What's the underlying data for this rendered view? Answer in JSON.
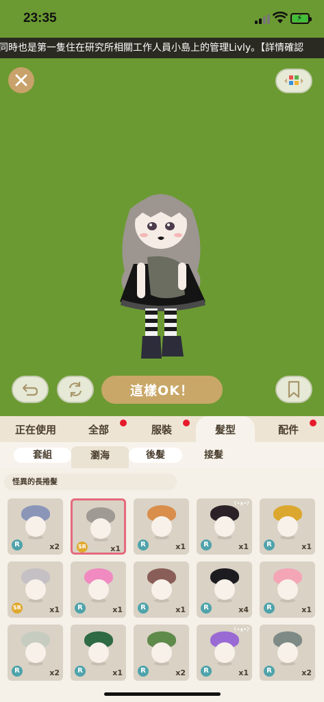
{
  "status_bar": {
    "time": "23:35"
  },
  "ticker": {
    "text": "同時也是第一隻住在研究所相關工作人員小島上的管理Livly。【詳情確認"
  },
  "stage": {
    "ok_label": "這樣OK！",
    "background_color": "#6b9a32"
  },
  "tabs": [
    {
      "label": "正在使用",
      "dot": false
    },
    {
      "label": "全部",
      "dot": true
    },
    {
      "label": "服裝",
      "dot": true
    },
    {
      "label": "髮型",
      "dot": false,
      "active": true
    },
    {
      "label": "配件",
      "dot": true
    }
  ],
  "subtabs": [
    {
      "label": "套組"
    },
    {
      "label": "瀏海",
      "active": true
    },
    {
      "label": "後髮"
    },
    {
      "label": "接髮"
    }
  ],
  "item_name": "怪異的長捲髮",
  "items": [
    {
      "rarity": "R",
      "count": "x2",
      "hair": "#8a95b8",
      "bear": false
    },
    {
      "rarity": "SR",
      "count": "x1",
      "hair": "#a09a94",
      "bear": false,
      "selected": true
    },
    {
      "rarity": "R",
      "count": "x1",
      "hair": "#d98e4c",
      "bear": false
    },
    {
      "rarity": "R",
      "count": "x1",
      "hair": "#2a2226",
      "bear": true
    },
    {
      "rarity": "R",
      "count": "x1",
      "hair": "#dca72e",
      "bear": false
    },
    {
      "rarity": "SR",
      "count": "x1",
      "hair": "#c4c0c4",
      "bear": false
    },
    {
      "rarity": "R",
      "count": "x1",
      "hair": "#f08ac0",
      "bear": false
    },
    {
      "rarity": "R",
      "count": "x1",
      "hair": "#8a5e58",
      "bear": false
    },
    {
      "rarity": "R",
      "count": "x4",
      "hair": "#1c1c20",
      "bear": false
    },
    {
      "rarity": "R",
      "count": "x1",
      "hair": "#f4a6b6",
      "bear": false
    },
    {
      "rarity": "R",
      "count": "x2",
      "hair": "#c6ccc0",
      "bear": false
    },
    {
      "rarity": "R",
      "count": "x1",
      "hair": "#2e6a44",
      "bear": false
    },
    {
      "rarity": "R",
      "count": "x2",
      "hair": "#5e8a4a",
      "bear": false
    },
    {
      "rarity": "R",
      "count": "x1",
      "hair": "#9a6ad4",
      "bear": true
    },
    {
      "rarity": "R",
      "count": "x2",
      "hair": "#7e8a86",
      "bear": false
    }
  ]
}
